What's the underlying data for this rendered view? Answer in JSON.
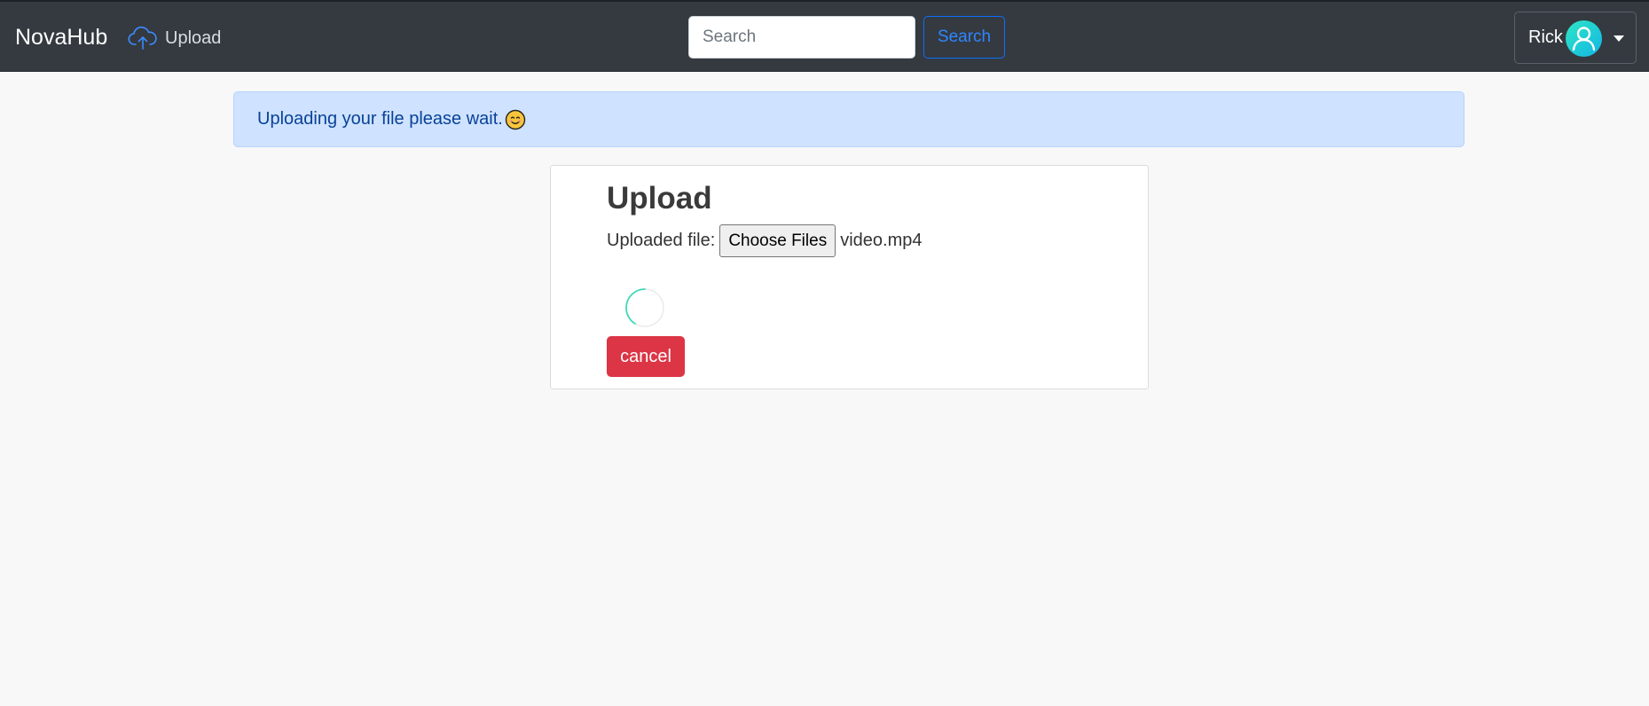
{
  "navbar": {
    "brand": "NovaHub",
    "upload_link": "Upload",
    "search_placeholder": "Search",
    "search_button": "Search",
    "user_name": "Rick"
  },
  "alert": {
    "message": "Uploading your file please wait."
  },
  "upload_card": {
    "title": "Upload",
    "file_label": "Uploaded file:",
    "choose_button": "Choose Files",
    "selected_file": "video.mp4",
    "cancel_button": "cancel"
  },
  "colors": {
    "navbar_bg": "#343a40",
    "alert_bg": "#cfe2ff",
    "cancel_bg": "#dc3545",
    "search_accent": "#0d6efd",
    "avatar_gradient": [
      "#2ee6c4",
      "#12b5e6"
    ]
  },
  "icons": {
    "upload": "cloud-upload-icon",
    "avatar": "user-avatar-icon",
    "emoji": "smiling-face-emoji",
    "loading": "loading-spinner-icon"
  }
}
